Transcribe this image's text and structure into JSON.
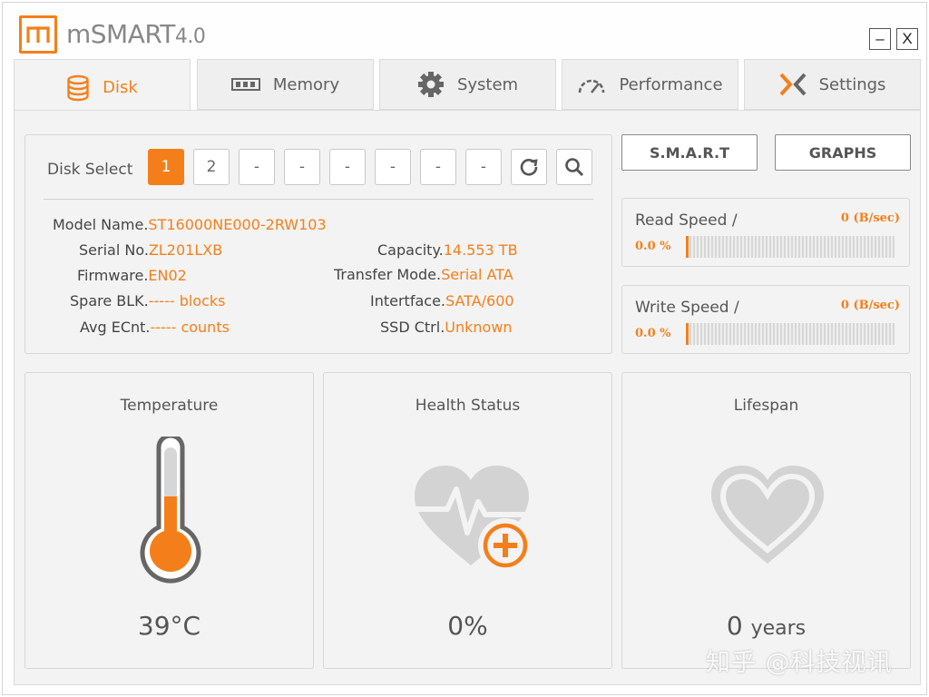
{
  "app": {
    "title": "mSMART",
    "version": "4.0",
    "minimize_label": "–",
    "close_label": "X"
  },
  "tabs": [
    {
      "label": "Disk",
      "icon": "database-icon",
      "active": true
    },
    {
      "label": "Memory",
      "icon": "memory-chip-icon",
      "active": false
    },
    {
      "label": "System",
      "icon": "gear-icon",
      "active": false
    },
    {
      "label": "Performance",
      "icon": "speedometer-icon",
      "active": false
    },
    {
      "label": "Settings",
      "icon": "x-logo-icon",
      "active": false
    }
  ],
  "disk_select": {
    "label": "Disk Select",
    "buttons": [
      "1",
      "2",
      "-",
      "-",
      "-",
      "-",
      "-",
      "-"
    ],
    "active_index": 0,
    "refresh_icon": "refresh-icon",
    "search_icon": "search-icon"
  },
  "disk_info": {
    "model_name_key": "Model Name.",
    "model_name": "ST16000NE000-2RW103",
    "serial_key": "Serial No.",
    "serial": "ZL201LXB",
    "firmware_key": "Firmware.",
    "firmware": "EN02",
    "spare_key": "Spare BLK.",
    "spare": "----- blocks",
    "ecnt_key": "Avg ECnt.",
    "ecnt": "----- counts",
    "capacity_key": "Capacity.",
    "capacity": "14.553 TB",
    "transfer_key": "Transfer Mode.",
    "transfer": "Serial ATA",
    "interface_key": "Intertface.",
    "interface": "SATA/600",
    "ssd_key": "SSD Ctrl.",
    "ssd": "Unknown"
  },
  "buttons": {
    "smart": "S.M.A.R.T",
    "graphs": "GRAPHS"
  },
  "read_speed": {
    "label": "Read Speed /",
    "value": "0 (B/sec)",
    "percent": "0.0 %",
    "level": 0.0
  },
  "write_speed": {
    "label": "Write Speed /",
    "value": "0 (B/sec)",
    "percent": "0.0 %",
    "level": 0.0
  },
  "temperature": {
    "title": "Temperature",
    "value": "39°C",
    "icon": "thermometer-icon"
  },
  "health": {
    "title": "Health Status",
    "value": "0%",
    "icon": "heart-pulse-plus-icon"
  },
  "lifespan": {
    "title": "Lifespan",
    "number": "0",
    "unit": "years",
    "icon": "heart-icon"
  },
  "watermark": {
    "text": "知乎 @科技视讯"
  },
  "colors": {
    "accent": "#f47f1a",
    "text": "#555555",
    "panel_bg": "#f3f3f3",
    "icon_gray": "#c8c8c8"
  }
}
